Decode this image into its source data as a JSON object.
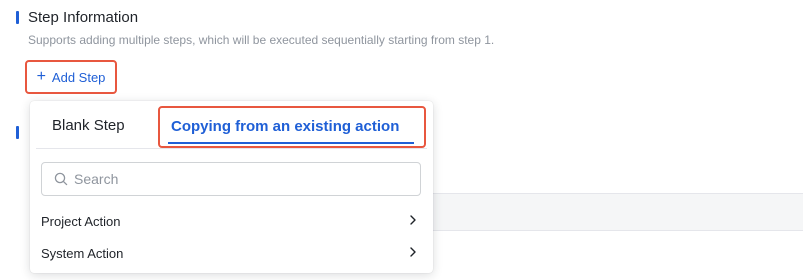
{
  "step_section": {
    "title": "Step Information",
    "description": "Supports adding multiple steps, which will be executed sequentially starting from step 1."
  },
  "add_step_button": {
    "icon": "plus-icon",
    "label": "Add Step"
  },
  "dropdown": {
    "tabs": [
      {
        "label": "Blank Step",
        "active": false
      },
      {
        "label": "Copying from an existing action",
        "active": true
      }
    ],
    "search": {
      "icon": "search-icon",
      "placeholder": "Search",
      "value": ""
    },
    "items": [
      {
        "label": "Project Action",
        "icon": "chevron-right-icon"
      },
      {
        "label": "System Action",
        "icon": "chevron-right-icon"
      }
    ]
  },
  "colors": {
    "accent": "#1f5fd6",
    "highlight_border": "#e8573f",
    "muted_text": "#8f959e"
  }
}
